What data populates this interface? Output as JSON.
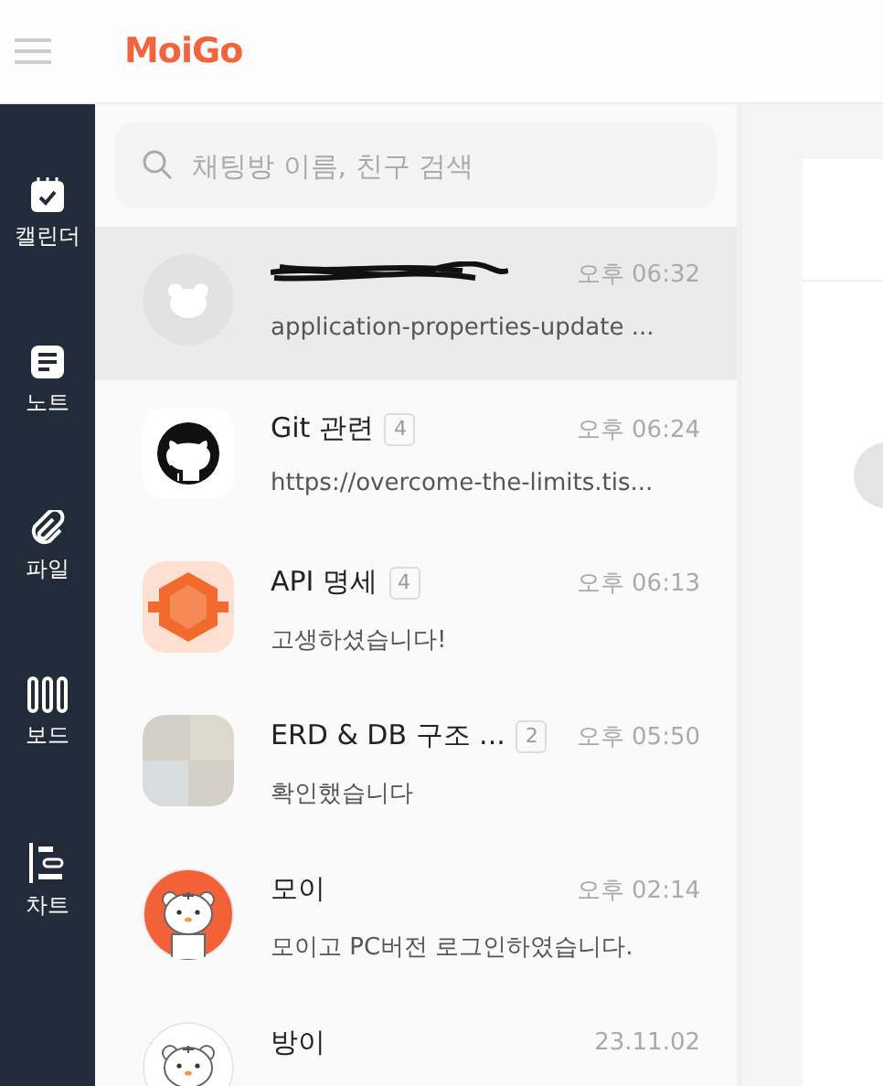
{
  "header": {
    "logo": "MoiGo"
  },
  "nav": [
    {
      "label": "캘린더"
    },
    {
      "label": "노트"
    },
    {
      "label": "파일"
    },
    {
      "label": "보드"
    },
    {
      "label": "차트"
    }
  ],
  "search": {
    "placeholder": "채팅방 이름, 친구 검색"
  },
  "chats": [
    {
      "name_redacted": true,
      "kind": "mascot-faded",
      "time": "오후 06:32",
      "preview": "application-properties-update ...",
      "selected": true
    },
    {
      "name": "Git 관련",
      "unread": "4",
      "kind": "github",
      "time": "오후 06:24",
      "preview": "https://overcome-the-limits.tis...",
      "selected": false
    },
    {
      "name": "API 명세",
      "unread": "4",
      "kind": "api",
      "time": "오후 06:13",
      "preview": "고생하셨습니다!",
      "selected": false
    },
    {
      "name": "ERD & DB 구조 ...",
      "unread": "2",
      "kind": "photo",
      "time": "오후 05:50",
      "preview": "확인했습니다",
      "selected": false
    },
    {
      "name": "모이",
      "kind": "mascot",
      "time": "오후 02:14",
      "preview": "모이고 PC버전 로그인하였습니다.",
      "selected": false
    },
    {
      "name": "방이",
      "kind": "mascot-plain",
      "time": "23.11.02",
      "selected": false
    }
  ]
}
